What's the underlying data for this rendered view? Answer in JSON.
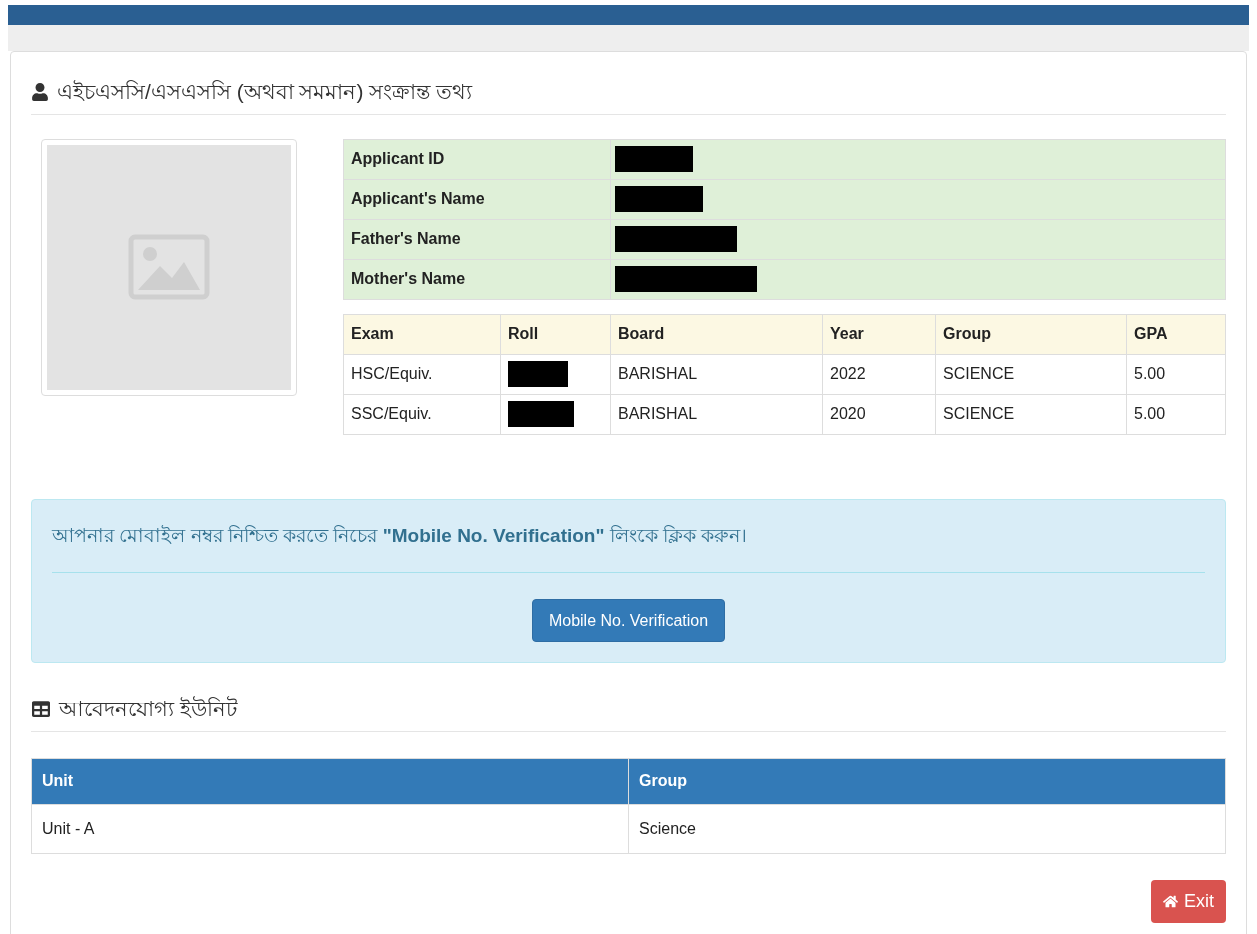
{
  "section_title": "এইচএসসি/এসএসসি (অথবা সমমান) সংক্রান্ত তথ্য",
  "photo": {
    "kind": "placeholder"
  },
  "applicant_info": [
    {
      "label": "Applicant ID",
      "redacted": true
    },
    {
      "label": "Applicant's Name",
      "redacted": true
    },
    {
      "label": "Father's Name",
      "redacted": true
    },
    {
      "label": "Mother's Name",
      "redacted": true
    }
  ],
  "exam_table": {
    "columns": [
      "Exam",
      "Roll",
      "Board",
      "Year",
      "Group",
      "GPA"
    ],
    "rows": [
      {
        "exam": "HSC/Equiv.",
        "roll_redacted": true,
        "board": "BARISHAL",
        "year": "2022",
        "group": "SCIENCE",
        "gpa": "5.00"
      },
      {
        "exam": "SSC/Equiv.",
        "roll_redacted": true,
        "board": "BARISHAL",
        "year": "2020",
        "group": "SCIENCE",
        "gpa": "5.00"
      }
    ]
  },
  "notice": {
    "message": "আপনার মোবাইল নম্বর নিশ্চিত করতে নিচের **\"Mobile No. Verification\"** লিংকে ক্লিক করুন।",
    "button": "Mobile No. Verification"
  },
  "units_title": "আবেদনযোগ্য ইউনিট",
  "units_table": {
    "columns": [
      "Unit",
      "Group"
    ],
    "rows": [
      [
        "Unit - A",
        "Science"
      ]
    ]
  },
  "exit_button": "Exit"
}
